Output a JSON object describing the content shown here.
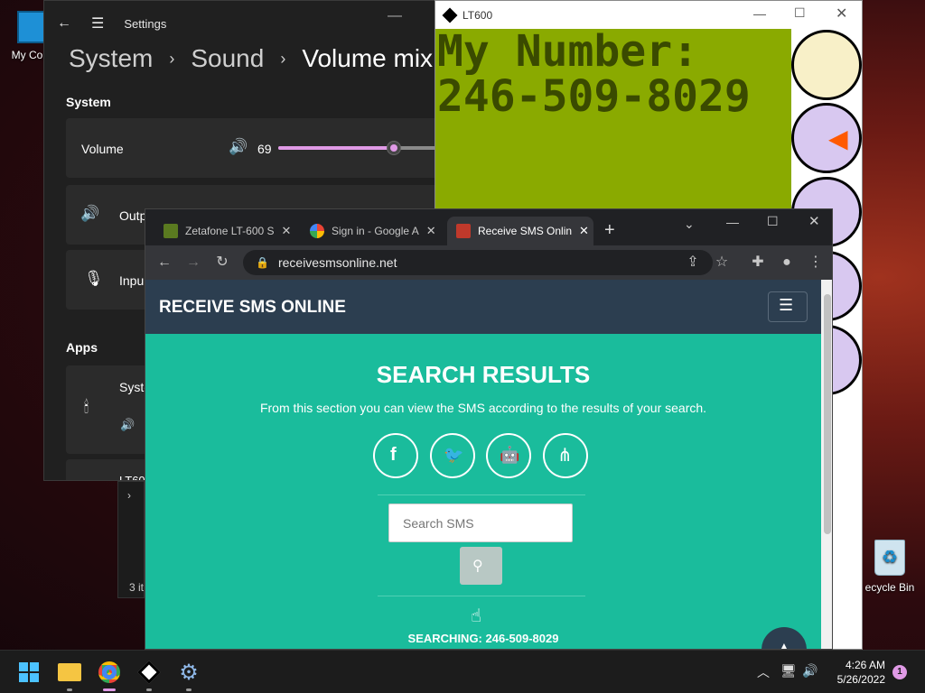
{
  "desktop": {
    "icon_my_computer": "My Com",
    "icon_recycle_bin": "ecycle Bin"
  },
  "settings": {
    "title": "Settings",
    "breadcrumb": [
      "System",
      "Sound",
      "Volume mix"
    ],
    "section_system": "System",
    "volume_label": "Volume",
    "volume_value": "69",
    "volume_level": 0.69,
    "output_label": "Outp",
    "input_label": "Inpu",
    "section_apps": "Apps",
    "app1_label": "Syste",
    "app2_label": "LT60",
    "accent_color": "#e09ae6"
  },
  "explorer": {
    "items_text": "3 it"
  },
  "lt600": {
    "title": "LT600",
    "lcd_line1": "My Number:",
    "lcd_line2": "246-509-8029",
    "lcd_color": "#8aaa00"
  },
  "chrome": {
    "tabs": [
      {
        "label": "Zetafone LT-600 S",
        "icon": "zetafone-favicon"
      },
      {
        "label": "Sign in - Google A",
        "icon": "google-favicon"
      },
      {
        "label": "Receive SMS Onlin",
        "icon": "sms-favicon"
      }
    ],
    "url": "receivesmsonline.net",
    "site": {
      "brand": "RECEIVE SMS ONLINE",
      "heading": "SEARCH RESULTS",
      "subtitle": "From this section you can view the SMS according to the results of your search.",
      "search_placeholder": "Search SMS",
      "searching_text": "SEARCHING: 246-509-8029",
      "teal": "#1abc9c",
      "navy": "#2c3e50"
    }
  },
  "taskbar": {
    "time": "4:26 AM",
    "date": "5/26/2022",
    "notification_count": "1"
  }
}
